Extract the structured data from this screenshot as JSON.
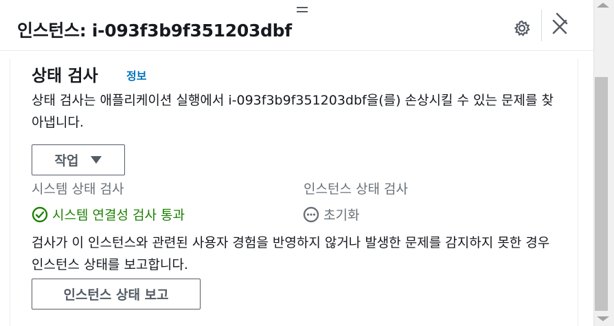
{
  "header": {
    "title": "인스턴스: i-093f3b9f351203dbf"
  },
  "section": {
    "title": "상태 검사",
    "info_link": "정보",
    "description": "상태 검사는 애플리케이션 실행에서 i-093f3b9f351203dbf을(를) 손상시킬 수 있는 문제를 찾아냅니다."
  },
  "actions_button": {
    "label": "작업"
  },
  "checks": {
    "system": {
      "label": "시스템 상태 검사",
      "status": "시스템 연결성 검사 통과",
      "status_icon": "check-circle-icon",
      "status_color": "#1d8102"
    },
    "instance": {
      "label": "인스턴스 상태 검사",
      "status": "초기화",
      "status_icon": "pending-icon",
      "status_color": "#687078"
    }
  },
  "report_text": "검사가 이 인스턴스와 관련된 사용자 경험을 반영하지 않거나 발생한 문제를 감지하지 못한 경우 인스턴스 상태를 보고합니다.",
  "report_button": {
    "label": "인스턴스 상태 보고"
  },
  "colors": {
    "link": "#0073bb",
    "success": "#1d8102",
    "muted": "#687078",
    "text": "#16191f"
  }
}
